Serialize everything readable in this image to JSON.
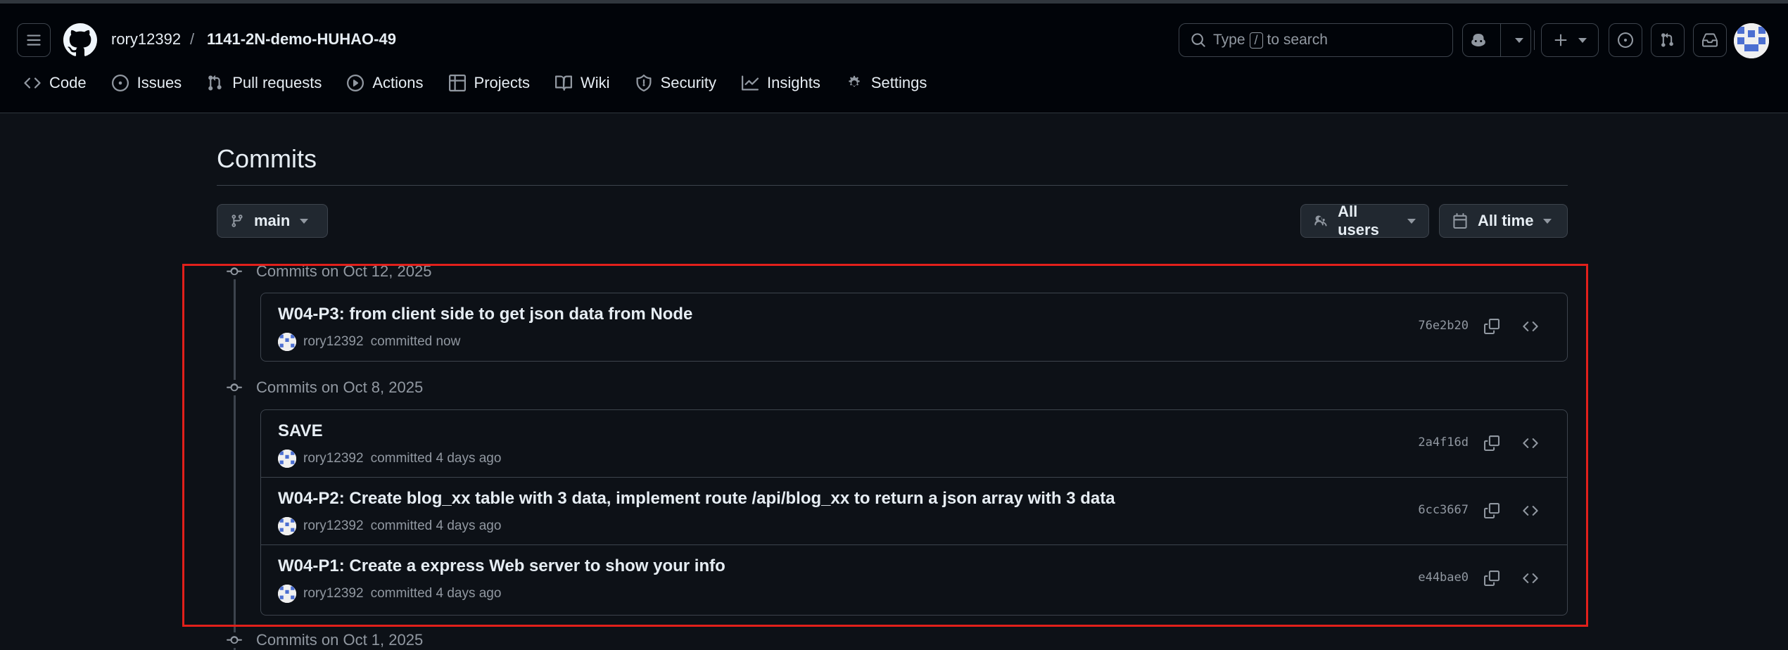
{
  "header": {
    "owner": "rory12392",
    "separator": "/",
    "repo": "1141-2N-demo-HUHAO-49",
    "search_prefix": "Type",
    "search_key": "/",
    "search_suffix": "to search"
  },
  "tabs": [
    {
      "label": "Code",
      "icon": "code-icon"
    },
    {
      "label": "Issues",
      "icon": "issue-icon"
    },
    {
      "label": "Pull requests",
      "icon": "pull-request-icon"
    },
    {
      "label": "Actions",
      "icon": "play-icon"
    },
    {
      "label": "Projects",
      "icon": "table-icon"
    },
    {
      "label": "Wiki",
      "icon": "book-icon"
    },
    {
      "label": "Security",
      "icon": "shield-icon"
    },
    {
      "label": "Insights",
      "icon": "graph-icon"
    },
    {
      "label": "Settings",
      "icon": "gear-icon"
    }
  ],
  "page": {
    "title": "Commits",
    "branch": "main",
    "users_filter": "All users",
    "time_filter": "All time"
  },
  "groups": [
    {
      "heading": "Commits on Oct 12, 2025",
      "commits": [
        {
          "message": "W04-P3: from client side to get json data from Node",
          "author": "rory12392",
          "time": "committed now",
          "sha": "76e2b20"
        }
      ]
    },
    {
      "heading": "Commits on Oct 8, 2025",
      "commits": [
        {
          "message": "SAVE",
          "author": "rory12392",
          "time": "committed 4 days ago",
          "sha": "2a4f16d"
        },
        {
          "message": "W04-P2: Create blog_xx table with 3 data, implement route /api/blog_xx to return a json array with 3 data",
          "author": "rory12392",
          "time": "committed 4 days ago",
          "sha": "6cc3667"
        },
        {
          "message": "W04-P1: Create a express Web server to show your info",
          "author": "rory12392",
          "time": "committed 4 days ago",
          "sha": "e44bae0"
        }
      ]
    },
    {
      "heading": "Commits on Oct 1, 2025",
      "commits": []
    }
  ],
  "colors": {
    "highlight": "#e1201b",
    "background": "#0d1117",
    "header": "#010409"
  }
}
